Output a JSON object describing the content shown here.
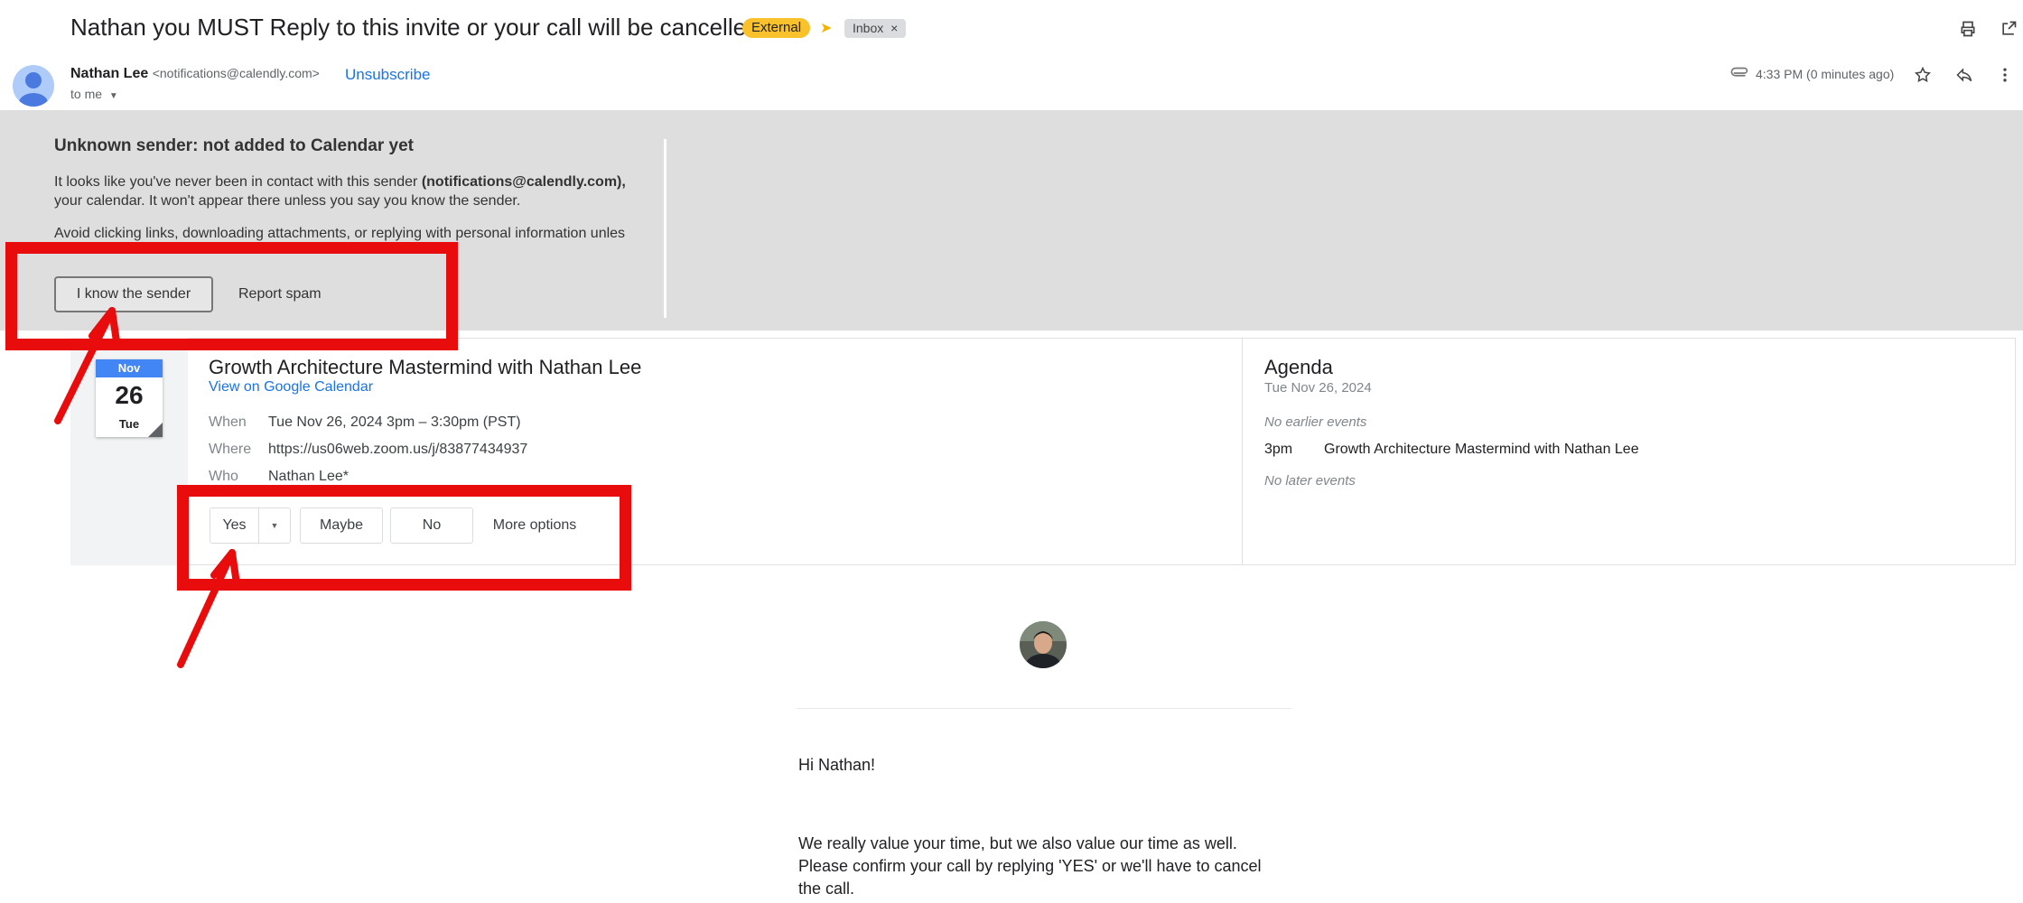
{
  "email": {
    "subject": "Nathan you MUST Reply to this invite or your call will be cancelled",
    "labels": {
      "external": "External",
      "inbox": "Inbox",
      "inbox_remove": "×"
    },
    "sender_name": "Nathan Lee",
    "sender_email": "<notifications@calendly.com>",
    "unsubscribe": "Unsubscribe",
    "to": "to me",
    "time": "4:33 PM (0 minutes ago)"
  },
  "warning": {
    "title": "Unknown sender: not added to Calendar yet",
    "text_prefix": "It looks like you've never been in contact with this sender ",
    "text_email": "(notifications@calendly.com),",
    "text_suffix": "your calendar. It won't appear there unless you say you know the sender.",
    "text2": "Avoid clicking links, downloading attachments, or replying with personal information unles",
    "know_button": "I know the sender",
    "spam_button": "Report spam"
  },
  "invite": {
    "month": "Nov",
    "day": "26",
    "dow": "Tue",
    "title": "Growth Architecture Mastermind with Nathan Lee",
    "calendar_link": "View on Google Calendar",
    "when_label": "When",
    "when_value": "Tue Nov 26, 2024 3pm – 3:30pm (PST)",
    "where_label": "Where",
    "where_value": "https://us06web.zoom.us/j/83877434937",
    "who_label": "Who",
    "who_value": "Nathan Lee*",
    "rsvp": {
      "yes": "Yes",
      "maybe": "Maybe",
      "no": "No",
      "more": "More options"
    }
  },
  "agenda": {
    "title": "Agenda",
    "date": "Tue Nov 26, 2024",
    "no_earlier": "No earlier events",
    "event_time": "3pm",
    "event_title": "Growth Architecture Mastermind with Nathan Lee",
    "no_later": "No later events"
  },
  "body": {
    "greeting": "Hi Nathan!",
    "line1": "We really value your time, but we also value our time as well.",
    "line2": "Please confirm your call by replying 'YES' or we'll have to cancel",
    "line3": "the call."
  },
  "colors": {
    "annotation_red": "#e80c0c",
    "link_blue": "#1a73e8",
    "external_chip": "#f9c12c"
  },
  "icons": [
    "print-icon",
    "open-new-window-icon",
    "attachment-icon",
    "star-icon",
    "reply-icon",
    "more-vert-icon",
    "chevron-down-icon",
    "important-marker-icon"
  ]
}
